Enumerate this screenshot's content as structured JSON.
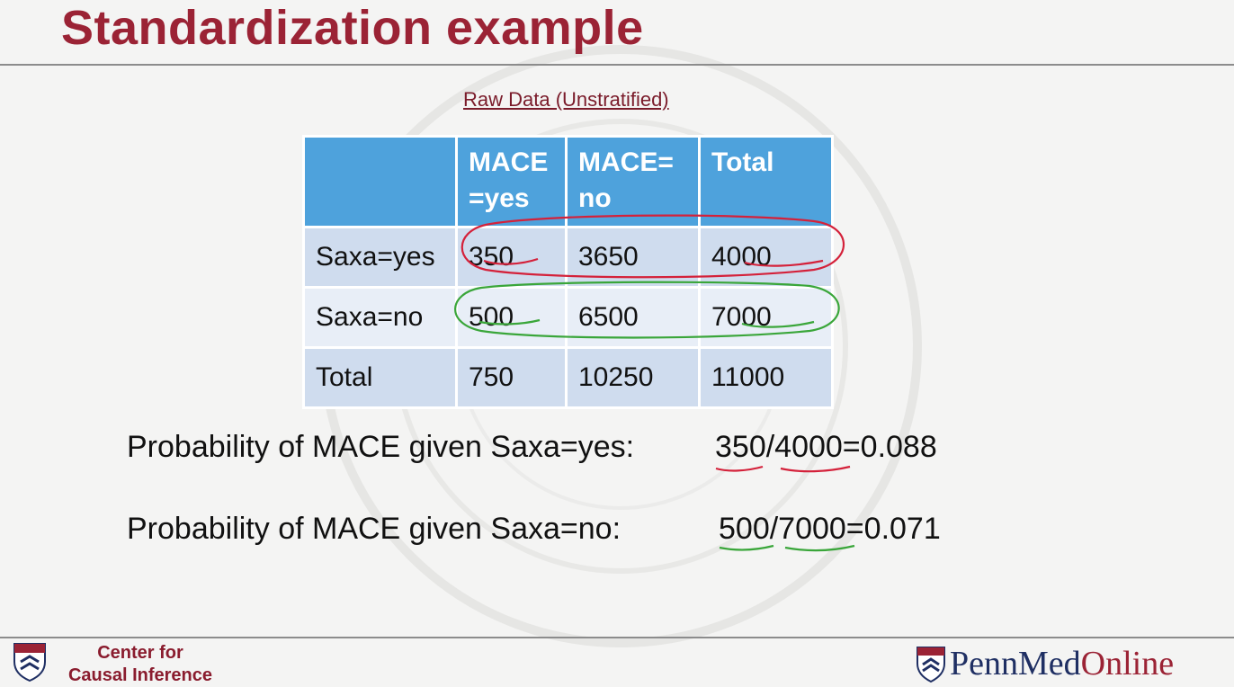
{
  "slide": {
    "title": "Standardization example",
    "table_caption": "Raw Data (Unstratified)",
    "table": {
      "headers": [
        "",
        "MACE =yes",
        "MACE= no",
        "Total"
      ],
      "rows": [
        [
          "Saxa=yes",
          "350",
          "3650",
          "4000"
        ],
        [
          "Saxa=no",
          "500",
          "6500",
          "7000"
        ],
        [
          "Total",
          "750",
          "10250",
          "11000"
        ]
      ]
    },
    "probabilities": [
      {
        "label": "Probability of MACE given Saxa=yes:",
        "value": "350/4000=0.088"
      },
      {
        "label": "Probability of MACE given Saxa=no:",
        "value": "500/7000=0.071"
      }
    ]
  },
  "footer": {
    "left_logo_line1": "Center for",
    "left_logo_line2": "Causal Inference",
    "right_logo_part1": "PennMed",
    "right_logo_part2": "Online"
  },
  "colors": {
    "title": "#9b2335",
    "header_fill": "#4ea2dc",
    "row_fill_dark": "#cfdcee",
    "row_fill_light": "#e8eef7",
    "annotation_red": "#d4213a",
    "annotation_green": "#3aa63a"
  }
}
